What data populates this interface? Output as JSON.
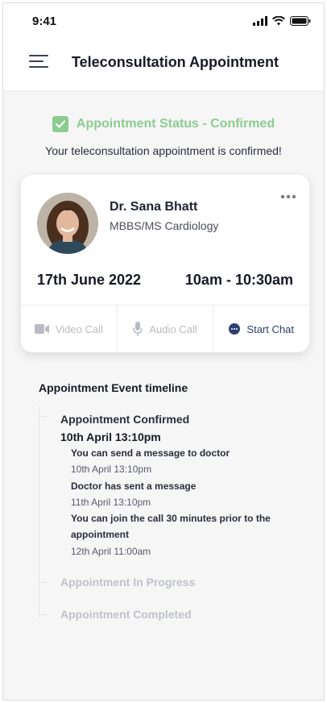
{
  "status_bar": {
    "time": "9:41"
  },
  "header": {
    "title": "Teleconsultation Appointment"
  },
  "appointment": {
    "status_label": "Appointment Status - Confirmed",
    "confirmation_message": "Your teleconsultation appointment is confirmed!"
  },
  "doctor": {
    "name": "Dr. Sana Bhatt",
    "specialization": "MBBS/MS Cardiology"
  },
  "schedule": {
    "date": "17th June 2022",
    "time_slot": "10am - 10:30am"
  },
  "actions": [
    {
      "label": "Video Call",
      "icon": "video-camera-icon",
      "enabled": false
    },
    {
      "label": "Audio Call",
      "icon": "microphone-icon",
      "enabled": false
    },
    {
      "label": "Start Chat",
      "icon": "chat-bubble-icon",
      "enabled": true
    }
  ],
  "timeline": {
    "heading": "Appointment Event timeline",
    "events": [
      {
        "title": "Appointment Confirmed",
        "timestamp": "10th April 13:10pm",
        "active": true
      },
      {
        "title": "Appointment In Progress",
        "active": false
      },
      {
        "title": "Appointment Completed",
        "active": false
      }
    ],
    "messages": [
      {
        "text": "You can send a message to doctor",
        "time": "10th April 13:10pm"
      },
      {
        "text": "Doctor has sent a message",
        "time": "11th April 13:10pm"
      },
      {
        "text": "You can join the call 30 minutes prior to the appointment",
        "time": "12th April 11:00am"
      }
    ]
  },
  "colors": {
    "success": "#8ccc8f",
    "accent": "#2d3f6f",
    "muted": "#b9bbc4"
  }
}
